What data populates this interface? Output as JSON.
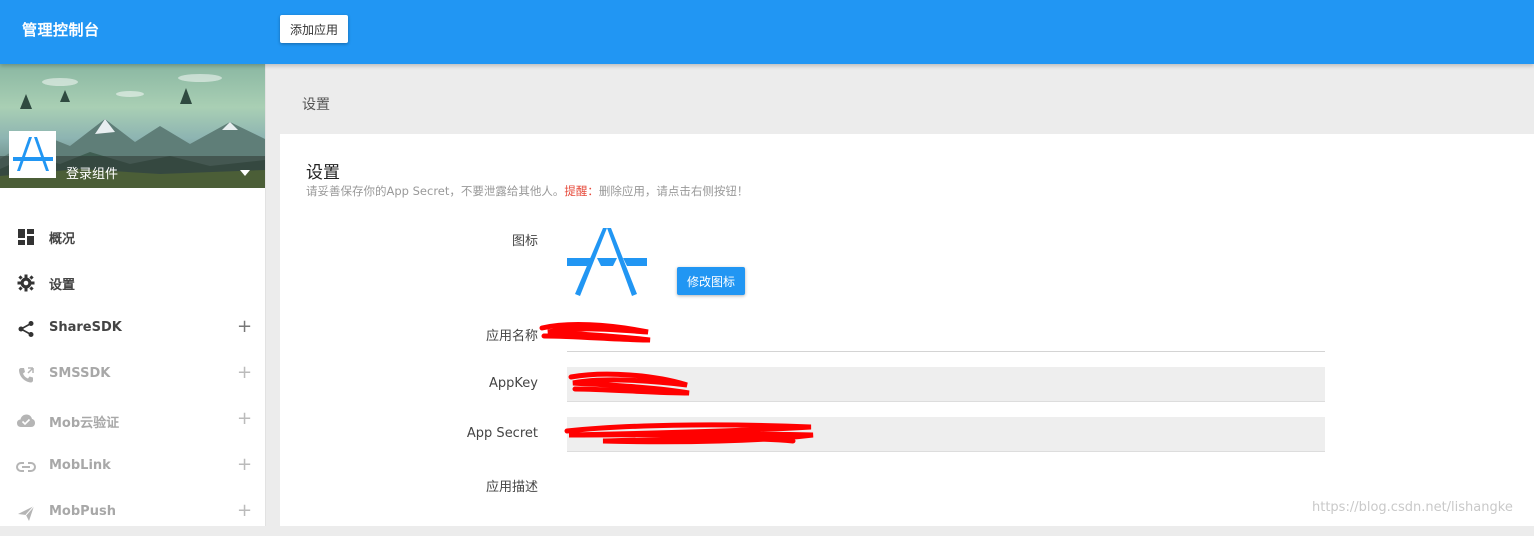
{
  "header": {
    "title": "管理控制台",
    "add_app_label": "添加应用",
    "color": "#2196f3"
  },
  "sidebar": {
    "app_name": "登录组件",
    "items": [
      {
        "label": "概况",
        "icon": "dashboard-icon",
        "enabled": true,
        "expandable": false
      },
      {
        "label": "设置",
        "icon": "gear-icon",
        "enabled": true,
        "expandable": false
      },
      {
        "label": "ShareSDK",
        "icon": "share-icon",
        "enabled": true,
        "expandable": true,
        "expand_symbol": "+"
      },
      {
        "label": "SMSSDK",
        "icon": "phone-icon",
        "enabled": false,
        "expandable": true,
        "expand_symbol": "+"
      },
      {
        "label": "Mob云验证",
        "icon": "cloud-check-icon",
        "enabled": false,
        "expandable": true,
        "expand_symbol": "+"
      },
      {
        "label": "MobLink",
        "icon": "link-icon",
        "enabled": false,
        "expandable": true,
        "expand_symbol": "+"
      },
      {
        "label": "MobPush",
        "icon": "send-icon",
        "enabled": false,
        "expandable": true,
        "expand_symbol": "+"
      }
    ]
  },
  "main": {
    "page_title": "设置",
    "card": {
      "title": "设置",
      "tip": "请妥善保存你的App Secret，不要泄露给其他人。",
      "warn_label": "提醒：",
      "warn_text": "删除应用，请点击右侧按钮！",
      "fields": {
        "icon_label": "图标",
        "change_icon_label": "修改图标",
        "app_name_label": "应用名称",
        "app_name_value": "",
        "appkey_label": "AppKey",
        "appkey_value": "",
        "app_secret_label": "App Secret",
        "app_secret_value": "",
        "app_desc_label": "应用描述"
      }
    }
  },
  "watermark": "https://blog.csdn.net/lishangke",
  "colors": {
    "accent": "#2196f3",
    "warn": "#e64a3b",
    "redaction": "#ff0000"
  }
}
